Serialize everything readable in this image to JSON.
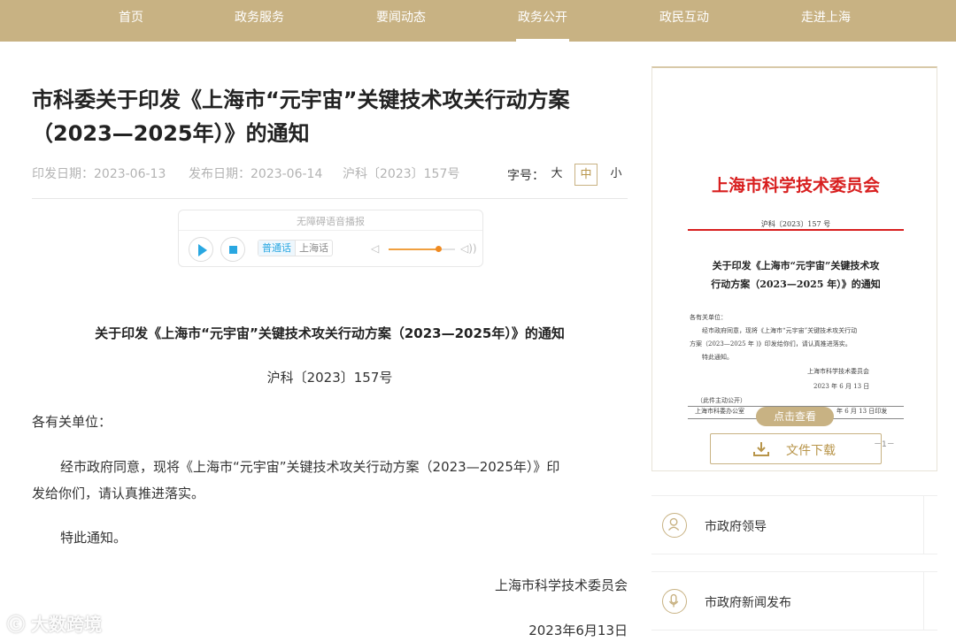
{
  "nav": {
    "items": [
      {
        "label": "首页"
      },
      {
        "label": "政务服务"
      },
      {
        "label": "要闻动态"
      },
      {
        "label": "政务公开"
      },
      {
        "label": "政民互动"
      },
      {
        "label": "走进上海"
      }
    ],
    "active": "政务公开",
    "bg_color": "#c8b283"
  },
  "article": {
    "title_line1": "市科委关于印发《上海市“元宇宙”关键技术攻关行动方案",
    "title_line2": "（2023—2025年）》的通知",
    "issue_date": "印发日期：2023-06-13",
    "publish_date": "发布日期：2023-06-14",
    "doc_number": "沪科〔2023〕157号",
    "font_size": {
      "label": "字号：",
      "large": "大",
      "medium": "中",
      "small": "小",
      "selected": "中"
    }
  },
  "audio_player": {
    "title": "无障碍语音播报",
    "lang_primary": "普通话",
    "lang_secondary": "上海话",
    "volume_level": 0.75
  },
  "body": {
    "heading": "关于印发《上海市“元宇宙”关键技术攻关行动方案（2023—2025年）》的通知",
    "doc_no": "沪科〔2023〕157号",
    "salutation": "各有关单位：",
    "paragraph1_line1": "经市政府同意，现将《上海市“元宇宙”关键技术攻关行动方案（2023—2025年）》印",
    "paragraph1_line2": "发给你们，请认真推进落实。",
    "paragraph2": "特此通知。",
    "signature_org": "上海市科学技术委员会",
    "signature_date": "2023年6月13日"
  },
  "preview": {
    "org_name": "上海市科学技术委员会",
    "doc_no": "沪科〔2023〕157 号",
    "title_line1": "关于印发《上海市“元宇宙”关键技术攻",
    "title_line2": "行动方案（2023—2025 年）》的通知",
    "salutation": "各有关单位：",
    "text_line1": "经市政府同意，现将《上海市“元宇宙”关键技术攻关行动",
    "text_line2": "方案（2023—2025 年 )》印发给你们，请认真推进落实。",
    "text_line3": "特此通知。",
    "sign_org": "上海市科学技术委员会",
    "sign_date": "2023 年 6 月 13 日",
    "public_note": "（此件主动公开）",
    "footer_left": "上海市科委办公室",
    "footer_right": "年 6 月 13 日印发",
    "view_button": "点击查看",
    "download_button": "文件下载",
    "page_number": "－1－",
    "org_color": "#d81e1e"
  },
  "sidebar_links": [
    {
      "label": "市政府领导",
      "icon": "leader-icon"
    },
    {
      "label": "市政府新闻发布",
      "icon": "microphone-icon"
    }
  ],
  "watermark": {
    "text": "大数跨境"
  }
}
